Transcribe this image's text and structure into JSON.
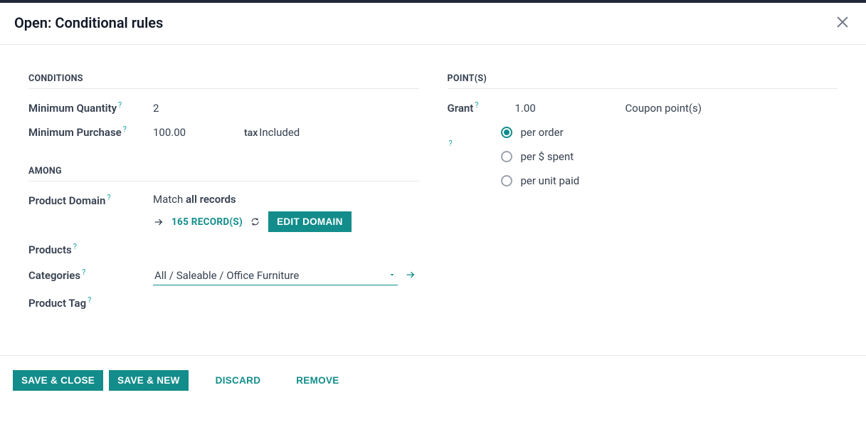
{
  "header": {
    "title": "Open: Conditional rules"
  },
  "conditions": {
    "heading": "CONDITIONS",
    "min_qty_label": "Minimum Quantity",
    "min_qty_value": "2",
    "min_purchase_label": "Minimum Purchase",
    "min_purchase_value": "100.00",
    "tax_label": "tax",
    "tax_value": "Included"
  },
  "among": {
    "heading": "AMONG",
    "product_domain_label": "Product Domain",
    "match_prefix": "Match ",
    "match_value": "all records",
    "records_link": "165 RECORD(S)",
    "edit_domain_btn": "EDIT DOMAIN",
    "products_label": "Products",
    "categories_label": "Categories",
    "categories_value": "All / Saleable / Office Furniture",
    "product_tag_label": "Product Tag"
  },
  "points": {
    "heading": "POINT(S)",
    "grant_label": "Grant",
    "grant_value": "1.00",
    "grant_unit": "Coupon point(s)",
    "radios": {
      "per_order": "per order",
      "per_spent": "per $ spent",
      "per_unit": "per unit paid"
    },
    "selected": "per_order"
  },
  "footer": {
    "save_close": "SAVE & CLOSE",
    "save_new": "SAVE & NEW",
    "discard": "DISCARD",
    "remove": "REMOVE"
  },
  "glyphs": {
    "help": "?"
  }
}
